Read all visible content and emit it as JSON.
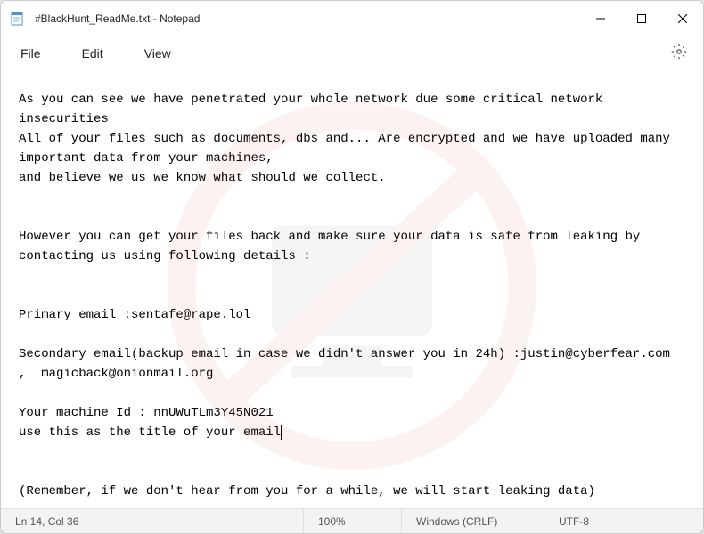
{
  "titlebar": {
    "title": "#BlackHunt_ReadMe.txt - Notepad"
  },
  "menu": {
    "file": "File",
    "edit": "Edit",
    "view": "View"
  },
  "content": {
    "text": "As you can see we have penetrated your whole network due some critical network insecurities\nAll of your files such as documents, dbs and... Are encrypted and we have uploaded many important data from your machines,\nand believe we us we know what should we collect.\n\n\nHowever you can get your files back and make sure your data is safe from leaking by contacting us using following details :\n\n\nPrimary email :sentafe@rape.lol\n\nSecondary email(backup email in case we didn't answer you in 24h) :justin@cyberfear.com  ,  magicback@onionmail.org\n\nYour machine Id : nnUWuTLm3Y45N021\nuse this as the title of your email"
  },
  "content_after": "\n\n\n(Remember, if we don't hear from you for a while, we will start leaking data)",
  "statusbar": {
    "position": "Ln 14, Col 36",
    "zoom": "100%",
    "lineending": "Windows (CRLF)",
    "encoding": "UTF-8"
  }
}
